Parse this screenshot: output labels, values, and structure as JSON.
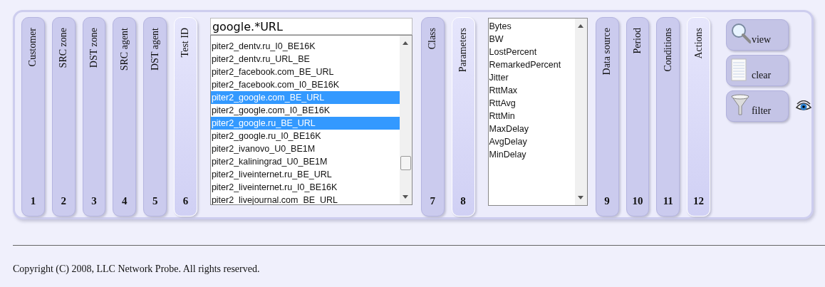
{
  "panel": {
    "columns": [
      {
        "kind": "tab",
        "label": "Customer",
        "number": "1",
        "selected": false
      },
      {
        "kind": "tab",
        "label": "SRC zone",
        "number": "2",
        "selected": false
      },
      {
        "kind": "tab",
        "label": "DST zone",
        "number": "3",
        "selected": false
      },
      {
        "kind": "tab",
        "label": "SRC agent",
        "number": "4",
        "selected": false
      },
      {
        "kind": "tab",
        "label": "DST agent",
        "number": "5",
        "selected": false
      },
      {
        "kind": "tab",
        "label": "Test ID",
        "number": "6",
        "selected": true
      },
      {
        "kind": "filter_list",
        "value": "google.*URL",
        "items": [
          {
            "label": "piter2_dentv.ru_I0_BE16K",
            "selected": false
          },
          {
            "label": "piter2_dentv.ru_URL_BE",
            "selected": false
          },
          {
            "label": "piter2_facebook.com_BE_URL",
            "selected": false
          },
          {
            "label": "piter2_facebook.com_I0_BE16K",
            "selected": false
          },
          {
            "label": "piter2_google.com_BE_URL",
            "selected": true
          },
          {
            "label": "piter2_google.com_I0_BE16K",
            "selected": false
          },
          {
            "label": "piter2_google.ru_BE_URL",
            "selected": true
          },
          {
            "label": "piter2_google.ru_I0_BE16K",
            "selected": false
          },
          {
            "label": "piter2_ivanovo_U0_BE1M",
            "selected": false
          },
          {
            "label": "piter2_kaliningrad_U0_BE1M",
            "selected": false
          },
          {
            "label": "piter2_liveinternet.ru_BE_URL",
            "selected": false
          },
          {
            "label": "piter2_liveinternet.ru_I0_BE16K",
            "selected": false
          },
          {
            "label": "piter2_livejournal.com_BE_URL",
            "selected": false
          }
        ]
      },
      {
        "kind": "tab",
        "label": "Class",
        "number": "7",
        "selected": false
      },
      {
        "kind": "tab",
        "label": "Parameters",
        "number": "8",
        "selected": true
      },
      {
        "kind": "list",
        "items": [
          {
            "label": "Bytes",
            "selected": false
          },
          {
            "label": "BW",
            "selected": false
          },
          {
            "label": "LostPercent",
            "selected": false
          },
          {
            "label": "RemarkedPercent",
            "selected": false
          },
          {
            "label": "Jitter",
            "selected": false
          },
          {
            "label": "RttMax",
            "selected": false
          },
          {
            "label": "RttAvg",
            "selected": false
          },
          {
            "label": "RttMin",
            "selected": false
          },
          {
            "label": "MaxDelay",
            "selected": false
          },
          {
            "label": "AvgDelay",
            "selected": false
          },
          {
            "label": "MinDelay",
            "selected": false
          }
        ]
      },
      {
        "kind": "tab",
        "label": "Data source",
        "number": "9",
        "selected": false
      },
      {
        "kind": "tab",
        "label": "Period",
        "number": "10",
        "selected": false
      },
      {
        "kind": "tab",
        "label": "Conditions",
        "number": "11",
        "selected": false
      },
      {
        "kind": "tab",
        "label": "Actions",
        "number": "12",
        "selected": true
      }
    ],
    "buttons": [
      {
        "kind": "view",
        "label": "view"
      },
      {
        "kind": "clear",
        "label": "clear"
      },
      {
        "kind": "filter",
        "label": "filter"
      }
    ]
  },
  "footer": {
    "copyright": "Copyright (C) 2008, LLC Network Probe. All rights reserved."
  }
}
